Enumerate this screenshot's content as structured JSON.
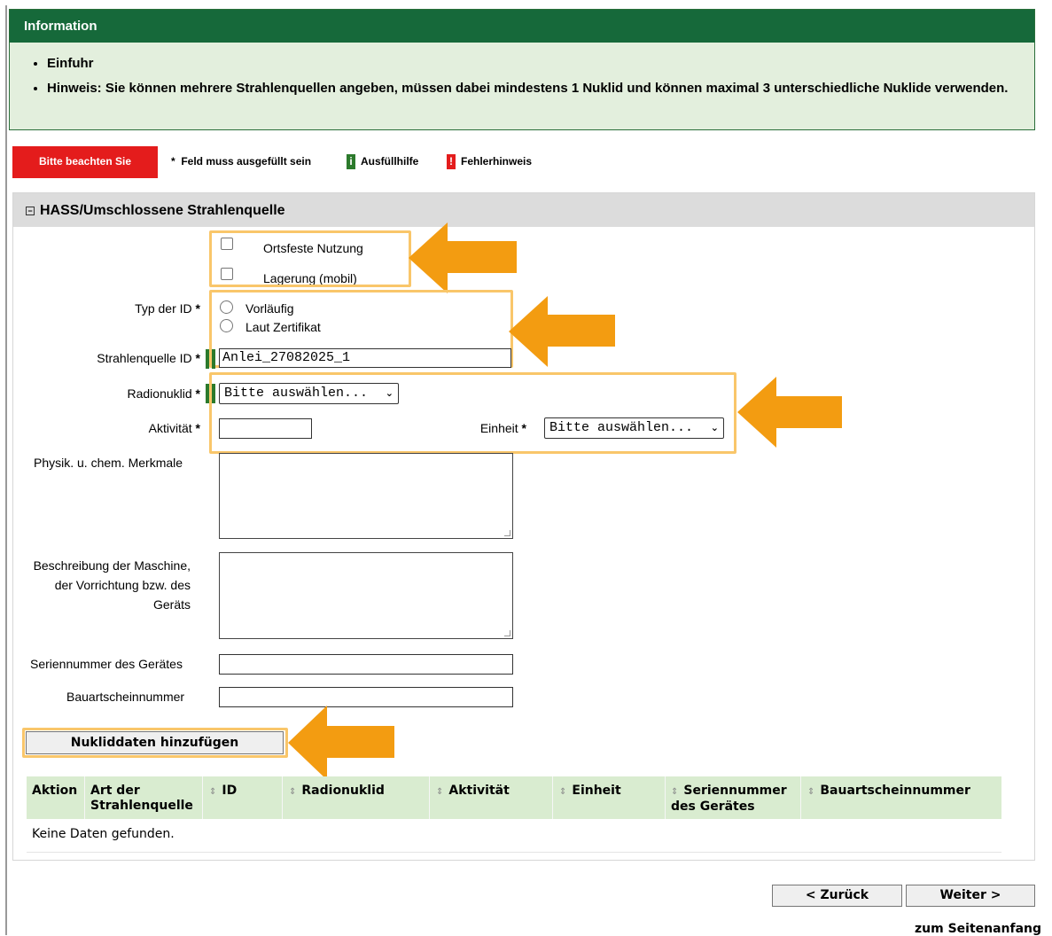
{
  "info": {
    "header": "Information",
    "bullets": [
      "Einfuhr",
      "Hinweis: Sie können mehrere Strahlenquellen angeben, müssen dabei mindestens 1 Nuklid und können maximal 3 unterschiedliche Nuklide verwenden."
    ]
  },
  "legend": {
    "notice": "Bitte beachten Sie",
    "required": "Feld muss ausgefüllt sein",
    "required_star": "*",
    "help_icon_glyph": "i",
    "help": "Ausfüllhilfe",
    "error_icon_glyph": "!",
    "error": "Fehlerhinweis"
  },
  "panel": {
    "toggle_glyph": "−",
    "title": "HASS/Umschlossene Strahlenquelle"
  },
  "form": {
    "checkboxes": [
      {
        "label": "Ortsfeste Nutzung",
        "checked": false
      },
      {
        "label": "Lagerung (mobil)",
        "checked": false
      }
    ],
    "id_type": {
      "label": "Typ der ID",
      "options": [
        "Vorläufig",
        "Laut Zertifikat"
      ]
    },
    "source_id": {
      "label": "Strahlenquelle ID",
      "value": "Anlei_27082025_1"
    },
    "radionuclide": {
      "label": "Radionuklid",
      "value": "Bitte auswählen..."
    },
    "activity": {
      "label": "Aktivität",
      "value": ""
    },
    "unit": {
      "label": "Einheit",
      "value": "Bitte auswählen..."
    },
    "properties": {
      "label": "Physik. u. chem. Merkmale"
    },
    "description": {
      "label_lines": [
        "Beschreibung der Maschine,",
        "der Vorrichtung bzw. des",
        "Geräts"
      ]
    },
    "serial": {
      "label": "Seriennummer des Gerätes",
      "value": ""
    },
    "type_approval": {
      "label": "Bauartscheinnummer",
      "value": ""
    },
    "required_star": "*",
    "chevron": "⌄"
  },
  "add_button": "Nukliddaten hinzufügen",
  "table": {
    "headers": [
      {
        "label": "Aktion",
        "sortable": false
      },
      {
        "label": "Art der Strahlenquelle",
        "sortable": false
      },
      {
        "label": "ID",
        "sortable": true
      },
      {
        "label": "Radionuklid",
        "sortable": true
      },
      {
        "label": "Aktivität",
        "sortable": true
      },
      {
        "label": "Einheit",
        "sortable": true
      },
      {
        "label": "Seriennummer des Gerätes",
        "sortable": true
      },
      {
        "label": "Bauartscheinnummer",
        "sortable": true
      }
    ],
    "sort_glyph": "⇕",
    "empty": "Keine Daten gefunden."
  },
  "nav": {
    "back": "< Zurück",
    "next": "Weiter >",
    "top": "zum Seitenanfang"
  },
  "colors": {
    "info_header": "#16693a",
    "info_bg": "#e3efdd",
    "notice_red": "#e41c1c",
    "highlight_border": "#f9c66a",
    "arrow": "#f39c11",
    "table_header": "#d9ecd0"
  }
}
